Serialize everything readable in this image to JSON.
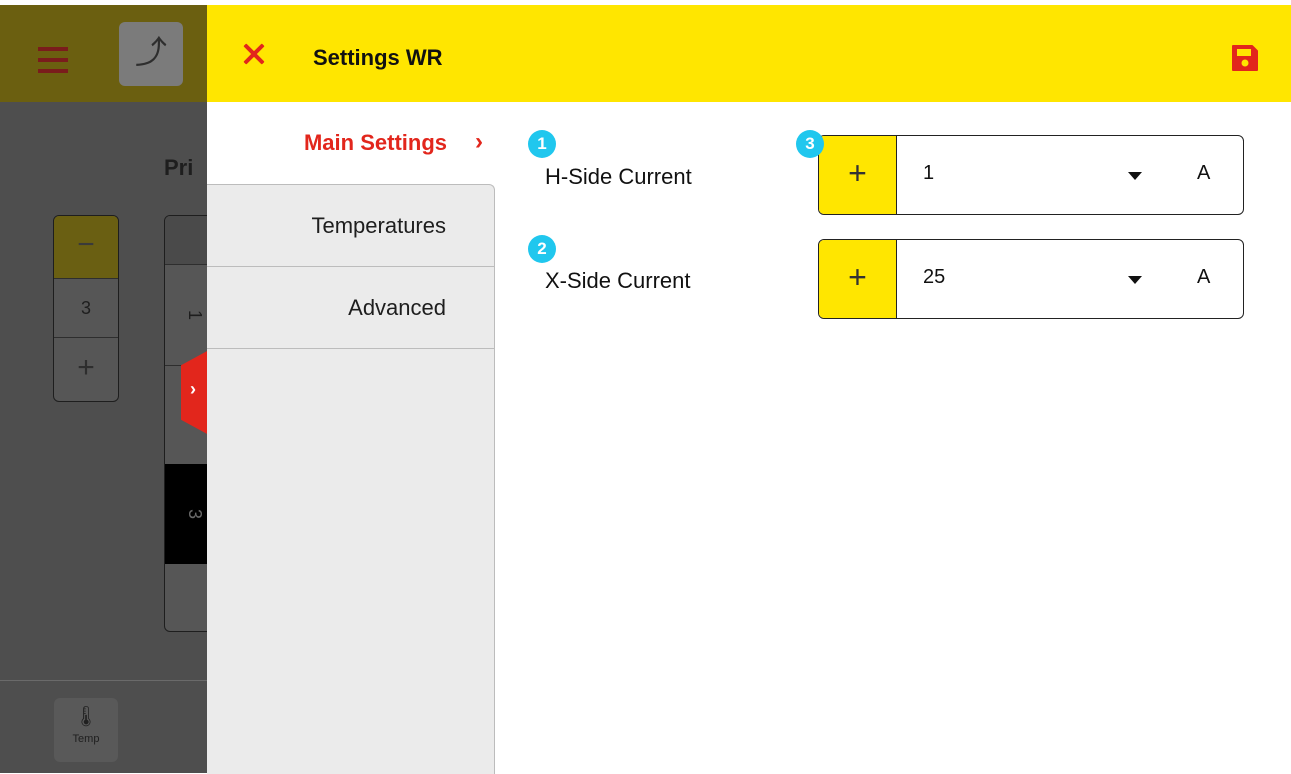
{
  "background": {
    "title": "Pri",
    "stepper": {
      "minus": "−",
      "value": "3",
      "plus": "+"
    },
    "column_values": [
      "1",
      "3"
    ],
    "temp_label": "Temp"
  },
  "header": {
    "title": "Settings WR",
    "accent_color": "#ffe600",
    "close_icon": "close-icon",
    "save_icon": "save-icon"
  },
  "sidenav": {
    "active": {
      "label": "Main Settings",
      "chevron": "›"
    },
    "items": [
      {
        "label": "Temperatures"
      },
      {
        "label": "Advanced"
      }
    ]
  },
  "settings": [
    {
      "badge": "1",
      "label": "H-Side Current",
      "plus": "+",
      "value": "1",
      "unit": "A"
    },
    {
      "badge": "2",
      "label": "X-Side Current",
      "plus": "+",
      "value": "25",
      "unit": "A"
    }
  ],
  "field_badge": "3"
}
